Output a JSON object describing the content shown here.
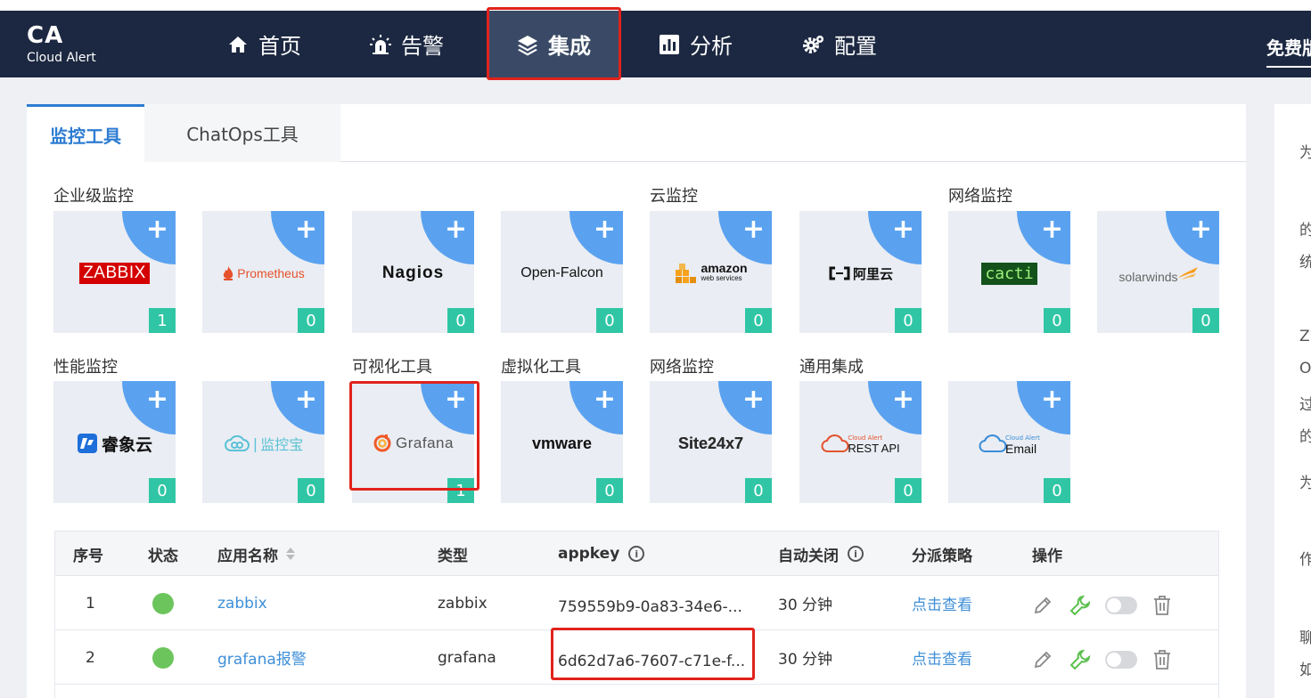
{
  "logo": {
    "title": "CA",
    "subtitle": "Cloud Alert"
  },
  "nav": {
    "items": [
      {
        "label": "首页",
        "icon": "home-icon"
      },
      {
        "label": "告警",
        "icon": "alarm-icon"
      },
      {
        "label": "集成",
        "icon": "layers-icon"
      },
      {
        "label": "分析",
        "icon": "chart-icon"
      },
      {
        "label": "配置",
        "icon": "gear-icon"
      }
    ],
    "active": "集成",
    "right_label": "免费版"
  },
  "tabs": {
    "monitor": "监控工具",
    "chatops": "ChatOps工具"
  },
  "categories": {
    "enterprise": "企业级监控",
    "cloud": "云监控",
    "network": "网络监控",
    "performance": "性能监控",
    "visualization": "可视化工具",
    "virtualization": "虚拟化工具",
    "network2": "网络监控",
    "general": "通用集成"
  },
  "tools": [
    {
      "name": "ZABBIX",
      "count": "1"
    },
    {
      "name": "Prometheus",
      "count": "0"
    },
    {
      "name": "Nagios",
      "count": "0"
    },
    {
      "name": "Open-Falcon",
      "count": "0"
    },
    {
      "name": "amazon",
      "sub": "web services",
      "count": "0"
    },
    {
      "name": "阿里云",
      "count": "0"
    },
    {
      "name": "cacti",
      "count": "0"
    },
    {
      "name": "solarwinds",
      "count": "0"
    },
    {
      "name": "睿象云",
      "count": "0"
    },
    {
      "name": "监控宝",
      "count": "0"
    },
    {
      "name": "Grafana",
      "count": "1"
    },
    {
      "name": "vmware",
      "count": "0"
    },
    {
      "name": "Site24x7",
      "count": "0"
    },
    {
      "name": "REST API",
      "sub": "Cloud Alert",
      "count": "0"
    },
    {
      "name": "Email",
      "sub": "Cloud Alert",
      "count": "0"
    }
  ],
  "table": {
    "headers": {
      "index": "序号",
      "status": "状态",
      "app_name": "应用名称",
      "type": "类型",
      "appkey": "appkey",
      "auto_close": "自动关闭",
      "dispatch": "分派策略",
      "actions": "操作"
    },
    "rows": [
      {
        "index": "1",
        "name": "zabbix",
        "type": "zabbix",
        "appkey": "759559b9-0a83-34e6-...",
        "auto_close": "30 分钟",
        "dispatch": "点击查看"
      },
      {
        "index": "2",
        "name": "grafana报警",
        "type": "grafana",
        "appkey": "6d62d7a6-7607-c71e-f...",
        "auto_close": "30 分钟",
        "dispatch": "点击查看"
      }
    ]
  },
  "right_panel": {
    "chars": [
      "为",
      "的",
      "统",
      "Z",
      "O",
      "过",
      "的",
      "为",
      "作",
      "聊",
      "如"
    ]
  },
  "colors": {
    "navbar": "#1c2841",
    "accent": "#2d7cd1",
    "badge": "#30c6a5",
    "corner": "#5aa2f0",
    "highlight": "#e0231c",
    "status_ok": "#6cc55c"
  }
}
